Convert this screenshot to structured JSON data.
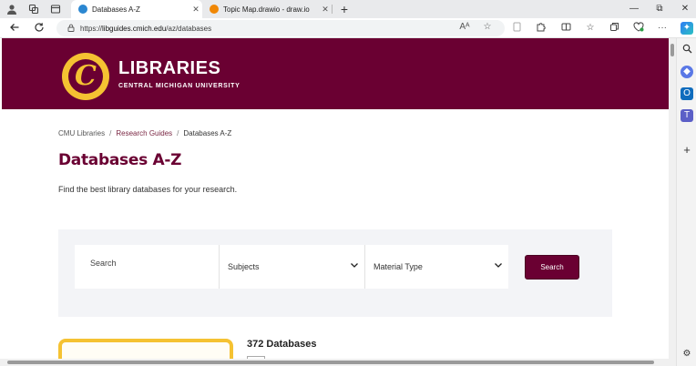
{
  "browser": {
    "tabs": [
      {
        "title": "Databases A-Z",
        "active": true,
        "favicon_color": "#2b87d1"
      },
      {
        "title": "Topic Map.drawio - draw.io",
        "active": false,
        "favicon_color": "#f08705"
      }
    ],
    "new_tab_label": "+",
    "window_controls": {
      "minimize": "—",
      "maximize": "⧉",
      "close": "✕"
    },
    "url_scheme": "https://",
    "url_host": "libguides.cmich.edu",
    "url_path": "/az/databases",
    "read_aloud_label": "Aᴬ"
  },
  "banner": {
    "logo_letter": "C",
    "title": "LIBRARIES",
    "subtitle": "CENTRAL MICHIGAN UNIVERSITY",
    "background": "#6a0032",
    "accent": "#f5c232"
  },
  "breadcrumb": {
    "items": [
      "CMU Libraries",
      "Research Guides",
      "Databases A-Z"
    ],
    "separator": "/"
  },
  "page": {
    "title": "Databases A-Z",
    "lead": "Find the best library databases for your research."
  },
  "search": {
    "input_placeholder": "Search",
    "subjects_label": "Subjects",
    "material_label": "Material Type",
    "button_label": "Search"
  },
  "results": {
    "count_label": "372 Databases"
  }
}
